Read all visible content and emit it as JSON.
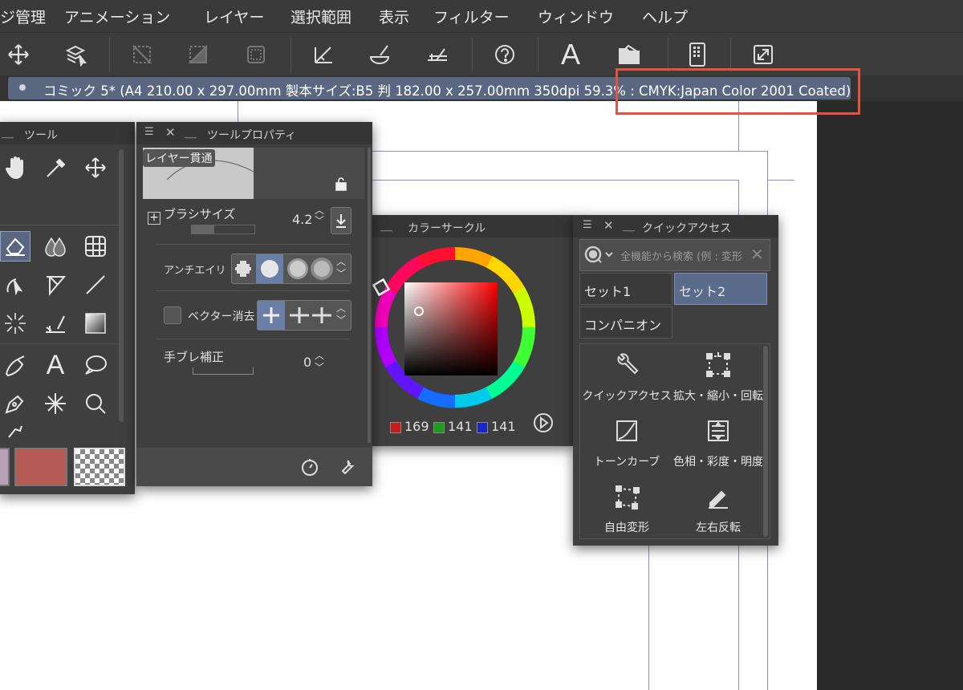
{
  "menubar": {
    "items": [
      "ジ管理",
      "アニメーション",
      "レイヤー",
      "選択範囲",
      "表示",
      "フィルター",
      "ウィンドウ",
      "ヘルプ"
    ]
  },
  "toolbar": {
    "icons": [
      "move-icon",
      "layer-select-icon",
      "deselect-icon",
      "invert-selection-icon",
      "selection-border-icon",
      "ruler-icon",
      "fill-icon",
      "snap-icon",
      "help-icon",
      "text-icon",
      "open-folder-icon",
      "device-icon",
      "expand-icon"
    ],
    "text_label": "A"
  },
  "document": {
    "tab_title": "コミック 5* (A4 210.00 x 297.00mm 製本サイズ:B5 判 182.00 x 257.00mm 350dpi 59.3% : CMYK:Japan Color 2001 Coated)"
  },
  "tool_panel": {
    "title": "ツール",
    "text_tool_label": "A"
  },
  "tool_property": {
    "title": "ツールプロパティ",
    "preview_label": "レイヤー貫通",
    "brush_size_label": "ブラシサイズ",
    "brush_size_value": "4.2",
    "antialias_label": "アンチエイリ",
    "vector_erase_label": "ベクター消去",
    "stabilization_label": "手ブレ補正",
    "stabilization_value": "0"
  },
  "color_circle": {
    "title": "カラーサークル",
    "r": "169",
    "g": "141",
    "b": "141",
    "main_color": "#b55a55"
  },
  "quick_access": {
    "title": "クイックアクセス",
    "search_placeholder": "全機能から検索 (例 : 変形",
    "sets": [
      "セット1",
      "セット2",
      "コンパニオン"
    ],
    "items": [
      {
        "label": "クイックアクセス",
        "icon": "wrench-icon"
      },
      {
        "label": "拡大・縮小・回転",
        "icon": "scale-icon"
      },
      {
        "label": "トーンカーブ",
        "icon": "tone-curve-icon"
      },
      {
        "label": "色相・彩度・明度",
        "icon": "hue-saturation-icon"
      },
      {
        "label": "自由変形",
        "icon": "free-transform-icon"
      },
      {
        "label": "左右反転",
        "icon": "flip-icon"
      }
    ]
  }
}
